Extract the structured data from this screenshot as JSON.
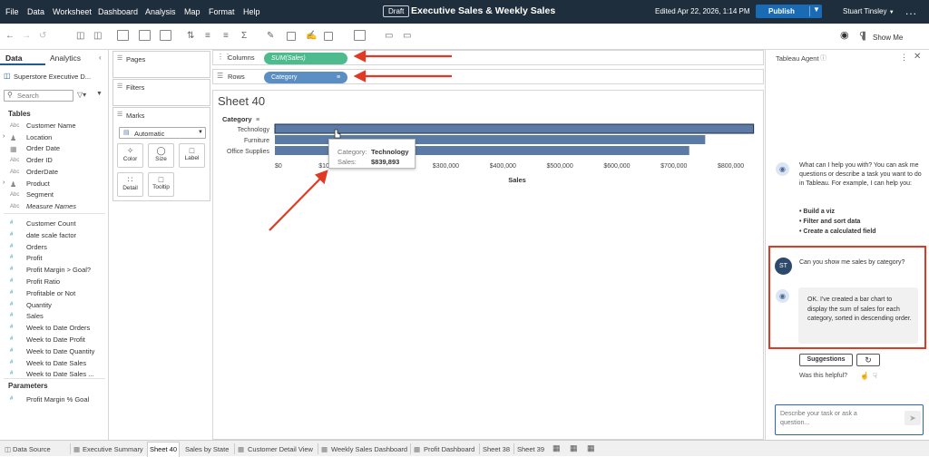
{
  "menubar": {
    "items": [
      "File",
      "Data",
      "Worksheet",
      "Dashboard",
      "Analysis",
      "Map",
      "Format",
      "Help"
    ],
    "draft_badge": "Draft",
    "title": "Executive Sales & Weekly Sales",
    "edited": "Edited Apr 22, 2026, 1:14 PM",
    "publish_label": "Publish",
    "user_name": "Stuart Tinsley",
    "more": "..."
  },
  "toolbar": {
    "show_me_label": "Show Me"
  },
  "left_panel": {
    "tabs": [
      "Data",
      "Analytics"
    ],
    "data_source": "Superstore Executive D...",
    "search_placeholder": "Search",
    "tables_header": "Tables",
    "dimensions": [
      {
        "name": "Customer Name",
        "icon": "Abc"
      },
      {
        "name": "Location",
        "icon": "person"
      },
      {
        "name": "Order Date",
        "icon": "calendar"
      },
      {
        "name": "Order ID",
        "icon": "Abc"
      },
      {
        "name": "OrderDate",
        "icon": "Abc"
      },
      {
        "name": "Product",
        "icon": "person"
      },
      {
        "name": "Segment",
        "icon": "Abc"
      },
      {
        "name": "Measure Names",
        "icon": "Abc"
      }
    ],
    "measures": [
      "Customer Count",
      "date scale factor",
      "Orders",
      "Profit",
      "Profit Margin > Goal?",
      "Profit Ratio",
      "Profitable or Not",
      "Quantity",
      "Sales",
      "Week to Date Orders",
      "Week to Date Profit",
      "Week to Date Quantity",
      "Week to Date Sales",
      "Week to Date Sales ..."
    ],
    "parameters_header": "Parameters",
    "parameters": [
      "Profit Margin % Goal"
    ]
  },
  "cards": {
    "pages_label": "Pages",
    "filters_label": "Filters",
    "marks_label": "Marks",
    "mark_type": "Automatic",
    "mark_buttons": [
      "Color",
      "Size",
      "Label",
      "Detail",
      "Tooltip"
    ]
  },
  "shelves": {
    "columns_label": "Columns",
    "columns_pill": "SUM(Sales)",
    "rows_label": "Rows",
    "rows_pill": "Category"
  },
  "sheet": {
    "title": "Sheet 40"
  },
  "chart_data": {
    "type": "bar",
    "orientation": "horizontal",
    "title": "",
    "ylabel": "Category",
    "xlabel": "Sales",
    "categories": [
      "Technology",
      "Furniture",
      "Office Supplies"
    ],
    "values": [
      839893,
      755000,
      727000
    ],
    "xlim": [
      0,
      850000
    ],
    "xticks": [
      0,
      100000,
      200000,
      300000,
      400000,
      500000,
      600000,
      700000,
      800000
    ],
    "xtick_labels": [
      "$0",
      "$100,000",
      "$200,000",
      "$300,000",
      "$400,000",
      "$500,000",
      "$600,000",
      "$700,000",
      "$800,000"
    ],
    "bar_color": "#5b7ba6",
    "grid": false,
    "legend": "none"
  },
  "tooltip": {
    "category_label": "Category:",
    "category_value": "Technology",
    "sales_label": "Sales:",
    "sales_value": "$839,893"
  },
  "agent": {
    "title": "Tableau Agent",
    "intro": "What can I help you with? You can ask me questions or describe a task you want to do in Tableau. For example, I can help you:",
    "bullets": [
      "Build a viz",
      "Filter and sort data",
      "Create a calculated field"
    ],
    "user_initials": "ST",
    "user_message": "Can you show me sales by category?",
    "agent_reply": "OK. I've created a bar chart to display the sum of sales for each category, sorted in descending order.",
    "suggestions_label": "Suggestions",
    "helpful_label": "Was this helpful?",
    "input_placeholder": "Describe your task or ask a question..."
  },
  "status_tabs": [
    "Data Source",
    "Executive Summary",
    "Sheet 40",
    "Sales by State",
    "Customer Detail View",
    "Weekly Sales Dashboard",
    "Profit Dashboard",
    "Sheet 38",
    "Sheet 39"
  ],
  "colors": {
    "menubar_bg": "#1f2e3c",
    "accent_blue": "#1a6bb5",
    "columns_pill": "#4dbb8e",
    "rows_pill": "#5b8fc4",
    "bar": "#5b7ba6",
    "highlight_red": "#e03a25"
  }
}
